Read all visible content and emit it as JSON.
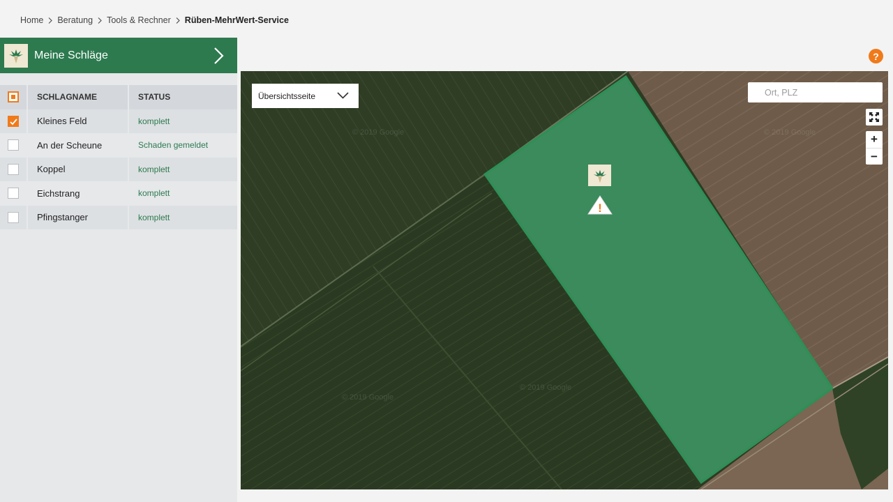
{
  "breadcrumb": {
    "items": [
      "Home",
      "Beratung",
      "Tools & Rechner"
    ],
    "current": "Rüben-MehrWert-Service"
  },
  "sidebar": {
    "title": "Meine Schläge",
    "columns": {
      "name": "SCHLAGNAME",
      "status": "STATUS"
    },
    "rows": [
      {
        "name": "Kleines Feld",
        "status": "komplett",
        "checked": true
      },
      {
        "name": "An der Scheune",
        "status": "Schaden gemeldet",
        "checked": false
      },
      {
        "name": "Koppel",
        "status": "komplett",
        "checked": false
      },
      {
        "name": "Eichstrang",
        "status": "komplett",
        "checked": false
      },
      {
        "name": "Pfingstanger",
        "status": "komplett",
        "checked": false
      }
    ]
  },
  "help": {
    "label": "?"
  },
  "map": {
    "view_select": "Übersichtsseite",
    "search_placeholder": "Ort, PLZ",
    "zoom_in": "+",
    "zoom_out": "−",
    "watermark": "© 2019 Google",
    "warning_mark": "!"
  },
  "colors": {
    "brand_green": "#2d7a4f",
    "accent_orange": "#f07a1a",
    "field_highlight": "#3fa06a"
  }
}
